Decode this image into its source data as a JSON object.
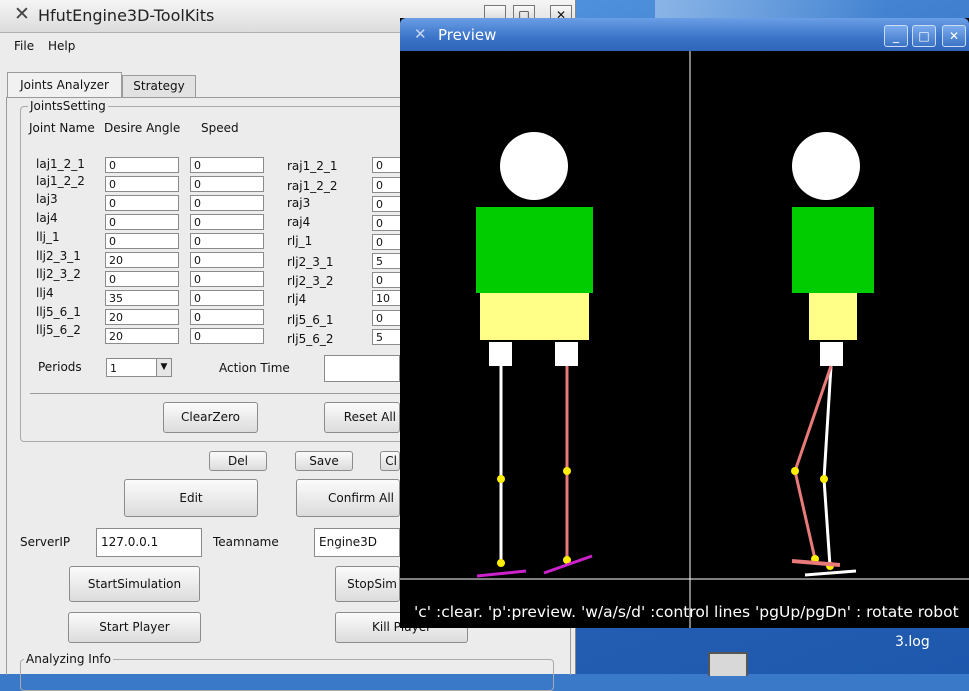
{
  "desktop": {
    "file_label": "3.log"
  },
  "main_window": {
    "title": "HfutEngine3D-ToolKits",
    "menu": {
      "file": "File",
      "help": "Help"
    },
    "tabs": {
      "joints": "Joints Analyzer",
      "strategy": "Strategy"
    },
    "joints_setting": {
      "group_label": "JointsSetting",
      "header": {
        "joint_name": "Joint Name",
        "desire_angle": "Desire Angle",
        "speed": "Speed"
      },
      "left_joints": [
        {
          "name": "laj1_2_1",
          "angle": "0",
          "speed": "0"
        },
        {
          "name": "laj1_2_2",
          "angle": "0",
          "speed": "0"
        },
        {
          "name": "laj3",
          "angle": "0",
          "speed": "0"
        },
        {
          "name": "laj4",
          "angle": "0",
          "speed": "0"
        },
        {
          "name": "llj_1",
          "angle": "0",
          "speed": "0"
        },
        {
          "name": "llj2_3_1",
          "angle": "20",
          "speed": "0"
        },
        {
          "name": "llj2_3_2",
          "angle": "0",
          "speed": "0"
        },
        {
          "name": "llj4",
          "angle": "35",
          "speed": "0"
        },
        {
          "name": "llj5_6_1",
          "angle": "20",
          "speed": "0"
        },
        {
          "name": "llj5_6_2",
          "angle": "20",
          "speed": "0"
        }
      ],
      "right_joints": [
        {
          "name": "raj1_2_1",
          "angle": "0"
        },
        {
          "name": "raj1_2_2",
          "angle": "0"
        },
        {
          "name": "raj3",
          "angle": "0"
        },
        {
          "name": "raj4",
          "angle": "0"
        },
        {
          "name": "rlj_1",
          "angle": "0"
        },
        {
          "name": "rlj2_3_1",
          "angle": "5"
        },
        {
          "name": "rlj2_3_2",
          "angle": "0"
        },
        {
          "name": "rlj4",
          "angle": "10"
        },
        {
          "name": "rlj5_6_1",
          "angle": "0"
        },
        {
          "name": "rlj5_6_2",
          "angle": "5"
        }
      ],
      "periods_label": "Periods",
      "periods_value": "1",
      "action_time_label": "Action Time",
      "clear_zero": "ClearZero",
      "reset_all": "Reset All"
    },
    "buttons": {
      "del": "Del",
      "save": "Save",
      "cl": "Cl",
      "edit": "Edit",
      "confirm_all": "Confirm All",
      "start_sim": "StartSimulation",
      "stop_sim": "StopSim",
      "start_player": "Start Player",
      "kill_player": "Kill Player"
    },
    "server": {
      "ip_label": "ServerIP",
      "ip_value": "127.0.0.1",
      "team_label": "Teamname",
      "team_value": "Engine3D"
    },
    "analyzing_label": "Analyzing Info"
  },
  "preview_window": {
    "title": "Preview",
    "status": "'c' :clear. 'p':preview. 'w/a/s/d' :control lines 'pgUp/pgDn' : rotate robot",
    "colors": {
      "head": "#ffffff",
      "torso": "#00cc00",
      "hip": "#ffff88",
      "left_leg": "#ffffff",
      "right_leg": "#e87a7a",
      "joint": "#ffee00",
      "foot": "#cc22cc"
    }
  }
}
